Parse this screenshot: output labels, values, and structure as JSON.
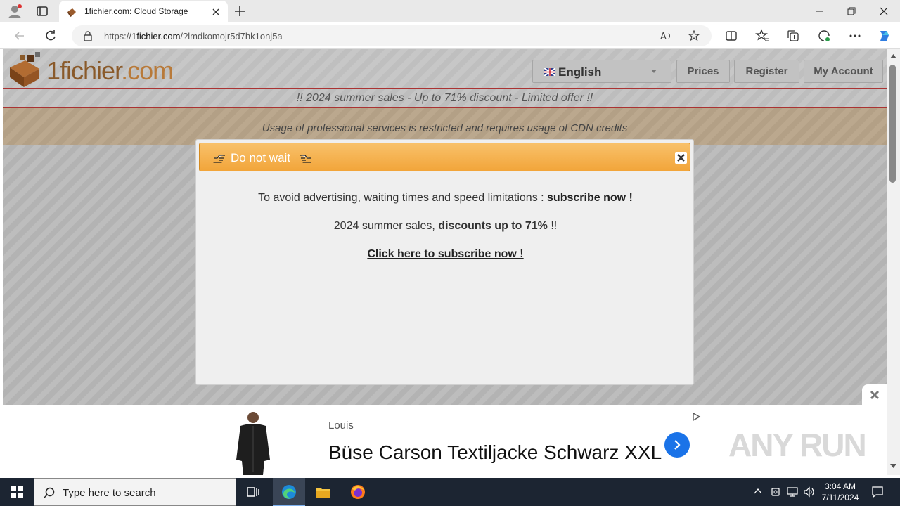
{
  "browser": {
    "tab_title": "1fichier.com: Cloud Storage",
    "url_prefix": "https://",
    "url_domain": "1fichier.com",
    "url_rest": "/?lmdkomojr5d7hk1onj5a"
  },
  "site": {
    "logo_name": "1fichier",
    "logo_domain": ".com",
    "language": "English",
    "nav": [
      "Prices",
      "Register",
      "My Account"
    ],
    "promo": "!! 2024 summer sales - Up to 71% discount - Limited offer !!",
    "notice": "Usage of professional services is restricted and requires usage of CDN credits"
  },
  "modal": {
    "title": "Do not wait",
    "line1_text": "To avoid advertising, waiting times and speed limitations : ",
    "line1_link": "subscribe now !",
    "line2_text": "2024 summer sales, ",
    "line2_bold": "discounts up to 71%",
    "line2_tail": " !!",
    "line3_link": "Click here to subscribe now !"
  },
  "ad": {
    "brand": "Louis",
    "product": "Büse Carson Textiljacke Schwarz XXL",
    "watermark": "ANY RUN"
  },
  "taskbar": {
    "search_placeholder": "Type here to search",
    "time": "3:04 AM",
    "date": "7/11/2024"
  },
  "colors": {
    "modal_header": "#f2a53a",
    "ad_button": "#1a73e8",
    "taskbar": "#1c2532"
  }
}
